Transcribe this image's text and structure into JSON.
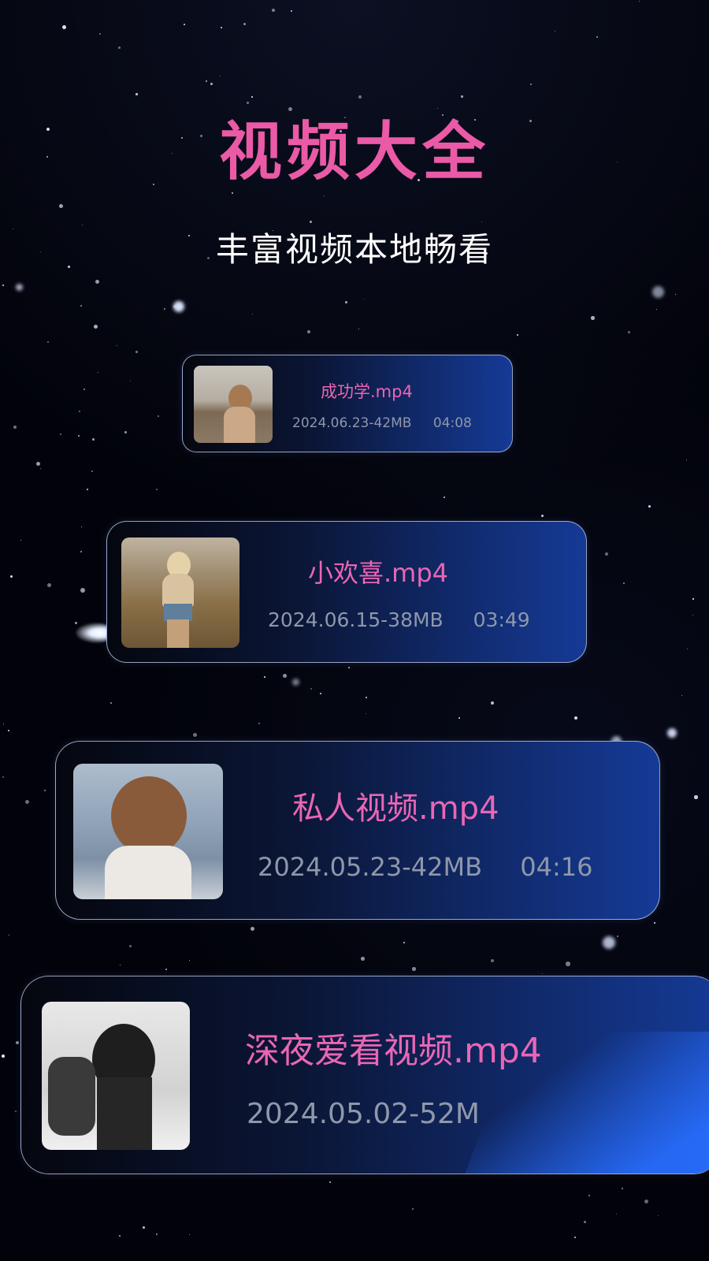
{
  "header": {
    "title": "视频大全",
    "subtitle": "丰富视频本地畅看"
  },
  "colors": {
    "title": "#ea5aa6",
    "subtitle": "#ffffff",
    "file_name": "#ea66b4",
    "meta": "#8f97aa",
    "card_gradient_end": "#153a96",
    "background": "#02030a"
  },
  "videos": [
    {
      "name": "成功学.mp4",
      "date_size": "2024.06.23-42MB",
      "duration": "04:08",
      "thumb_icon": "woman-at-beach-thumbnail"
    },
    {
      "name": "小欢喜.mp4",
      "date_size": "2024.06.15-38MB",
      "duration": "03:49",
      "thumb_icon": "woman-in-field-thumbnail"
    },
    {
      "name": "私人视频.mp4",
      "date_size": "2024.05.23-42MB",
      "duration": "04:16",
      "thumb_icon": "woman-by-sea-thumbnail"
    },
    {
      "name": "深夜爱看视频.mp4",
      "date_size": "2024.05.02-52M",
      "duration": "",
      "thumb_icon": "woman-bw-portrait-thumbnail"
    }
  ]
}
